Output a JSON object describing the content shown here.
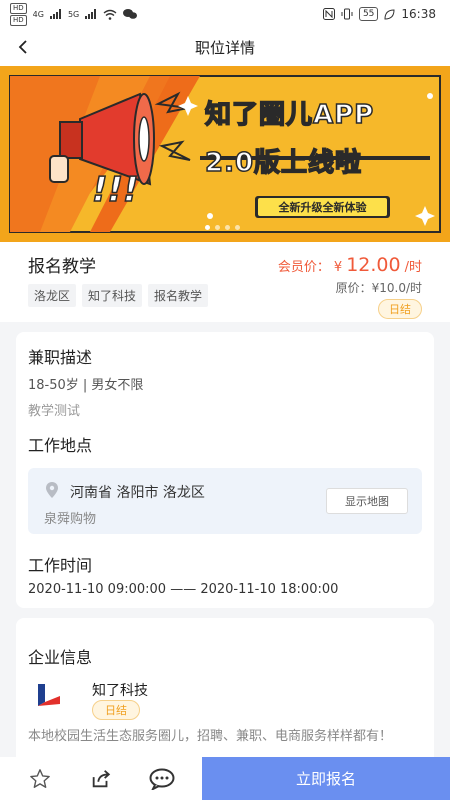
{
  "status_bar": {
    "left_tags": [
      "HD",
      "HD"
    ],
    "signal_text_1": "4G",
    "signal_text_2": "5G",
    "battery": "55",
    "time": "16:38"
  },
  "nav": {
    "title": "职位详情"
  },
  "banner": {
    "headline_1": "知了圈儿APP",
    "headline_2": "2.0版上线啦",
    "exclaim": "!!!",
    "subtitle": "全新升级全新体验"
  },
  "job": {
    "title": "报名教学",
    "tags": [
      "洛龙区",
      "知了科技",
      "报名教学"
    ],
    "member_price_label": "会员价：",
    "member_price_currency": "¥",
    "member_price_value": "12.00",
    "member_price_unit": "/时",
    "original_price": "原价：¥10.0/时",
    "settle_type": "日结"
  },
  "description": {
    "section_title": "兼职描述",
    "requirements": "18-50岁 | 男女不限",
    "detail": "教学测试",
    "location_title": "工作地点",
    "location_address": "河南省 洛阳市 洛龙区",
    "location_place": "泉舜购物",
    "map_button": "显示地图",
    "time_title": "工作时间",
    "time_range": "2020-11-10 09:00:00 —— 2020-11-10 18:00:00"
  },
  "company": {
    "section_title": "企业信息",
    "name": "知了科技",
    "badge": "日结",
    "description": "本地校园生活生态服务圈儿，招聘、兼职、电商服务样样都有！"
  },
  "bottom": {
    "apply_label": "立即报名"
  },
  "colors": {
    "accent": "#6a8ff0",
    "price": "#f05a3a",
    "badge": "#f0a020"
  }
}
